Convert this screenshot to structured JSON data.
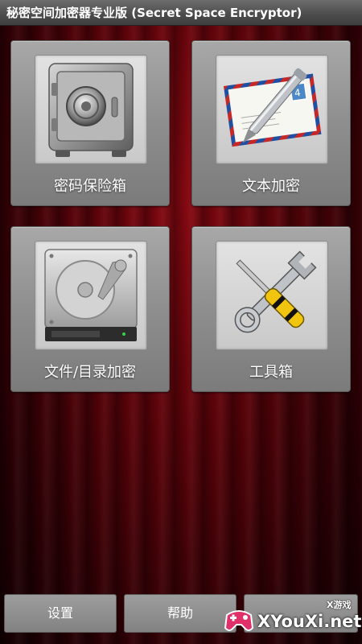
{
  "app": {
    "title": "秘密空间加密器专业版 (Secret Space Encryptor)"
  },
  "tiles": [
    {
      "label": "密码保险箱",
      "icon": "safe-icon"
    },
    {
      "label": "文本加密",
      "icon": "letter-pen-icon"
    },
    {
      "label": "文件/目录加密",
      "icon": "hard-drive-icon"
    },
    {
      "label": "工具箱",
      "icon": "wrench-screwdriver-icon"
    }
  ],
  "bottom_bar": {
    "settings_label": "设置",
    "help_label": "帮助"
  },
  "watermark": {
    "small_text": "X游戏",
    "site_text": "XYouXi.net"
  },
  "colors": {
    "background_red": "#5a0309",
    "tile_gray": "#8e8e8e",
    "title_bar": "#4b4b4b"
  }
}
